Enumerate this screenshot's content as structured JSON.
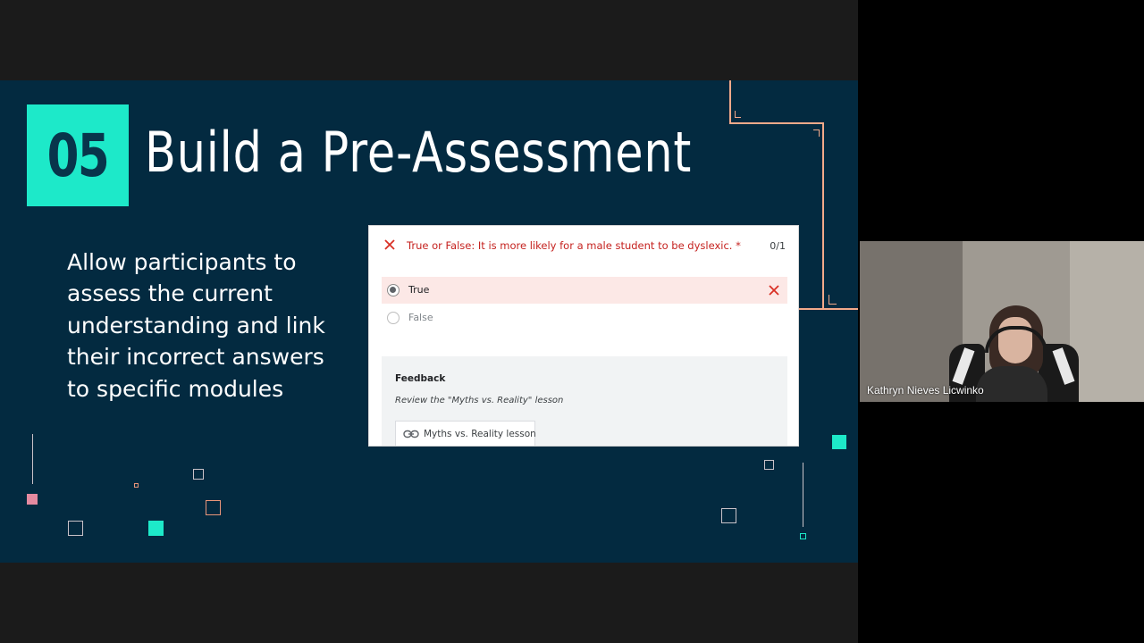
{
  "slide": {
    "number": "05",
    "title": "Build a Pre-Assessment",
    "body": "Allow participants to assess the current understanding and link their incorrect answers to specific modules"
  },
  "form": {
    "question": "True or False: It is more likely for a male student to be dyslexic. *",
    "score": "0/1",
    "options": [
      {
        "label": "True",
        "selected": true,
        "incorrect": true
      },
      {
        "label": "False",
        "selected": false,
        "incorrect": false
      }
    ],
    "feedback": {
      "title": "Feedback",
      "text": "Review the \"Myths vs. Reality\" lesson",
      "link_label": "Myths vs. Reality lesson"
    }
  },
  "video": {
    "participant_name": "Kathryn Nieves Licwinko"
  },
  "colors": {
    "slide_bg": "#032a40",
    "accent_teal": "#1de9c9",
    "accent_orange": "#f2a98a",
    "error_red": "#c5221f",
    "selected_bg": "#fce8e6"
  },
  "icons": {
    "question_status": "x-icon",
    "option_incorrect": "x-icon",
    "feedback_link": "link-icon"
  }
}
